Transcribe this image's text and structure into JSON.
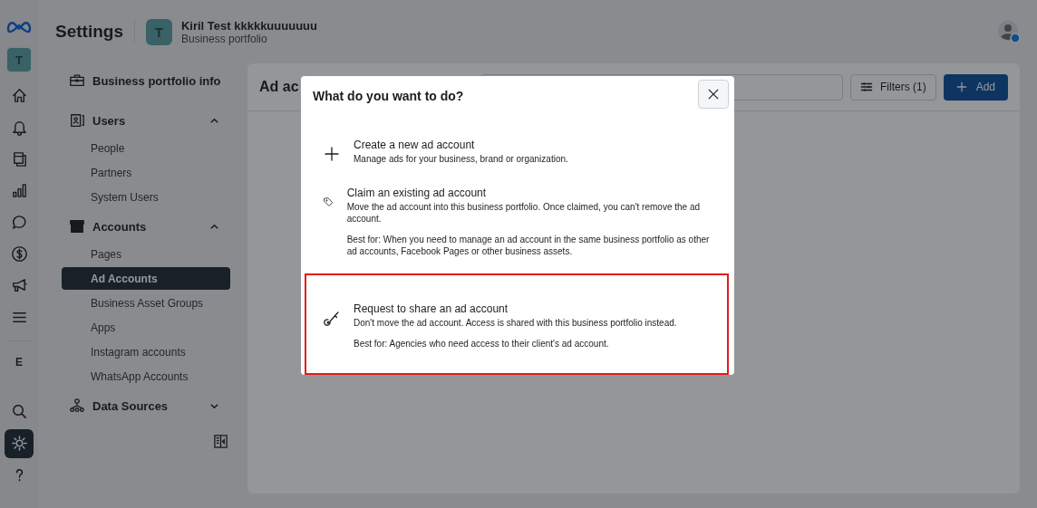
{
  "rail": {
    "account_initial": "T",
    "items": [
      {
        "kind": "home",
        "selected": false
      },
      {
        "kind": "bell",
        "selected": false
      },
      {
        "kind": "pages",
        "selected": false
      },
      {
        "kind": "chart",
        "selected": false
      },
      {
        "kind": "chat",
        "selected": false
      },
      {
        "kind": "dollar",
        "selected": false
      },
      {
        "kind": "megaphone",
        "selected": false
      },
      {
        "kind": "menu",
        "selected": false
      }
    ],
    "section_letter": "E",
    "bottom_items": [
      {
        "kind": "search",
        "selected": false
      },
      {
        "kind": "gear",
        "selected": true
      },
      {
        "kind": "help",
        "selected": false
      }
    ]
  },
  "header": {
    "title": "Settings",
    "portfolio_initial": "T",
    "portfolio_name": "Kiril Test kkkkkuuuuuuu",
    "portfolio_subtitle": "Business portfolio"
  },
  "sidebar": {
    "sections": [
      {
        "kind": "briefcase",
        "label": "Business portfolio info"
      },
      {
        "kind": "users",
        "label": "Users",
        "expanded": true,
        "children": [
          {
            "label": "People",
            "selected": false
          },
          {
            "label": "Partners",
            "selected": false
          },
          {
            "label": "System Users",
            "selected": false
          }
        ]
      },
      {
        "kind": "archive",
        "label": "Accounts",
        "expanded": true,
        "children": [
          {
            "label": "Pages",
            "selected": false
          },
          {
            "label": "Ad Accounts",
            "selected": true
          },
          {
            "label": "Business Asset Groups",
            "selected": false
          },
          {
            "label": "Apps",
            "selected": false
          },
          {
            "label": "Instagram accounts",
            "selected": false
          },
          {
            "label": "WhatsApp Accounts",
            "selected": false
          }
        ]
      },
      {
        "kind": "sources",
        "label": "Data Sources",
        "expanded": false
      }
    ]
  },
  "main": {
    "title": "Ad ac",
    "filters_button": "Filters (1)",
    "add_button": "Add"
  },
  "dialog": {
    "title": "What do you want to do?",
    "options": [
      {
        "kind": "plus",
        "title": "Create a new ad account",
        "description": "Manage ads for your business, brand or organization.",
        "highlighted": false
      },
      {
        "kind": "tag",
        "title": "Claim an existing ad account",
        "description": "Move the ad account into this business portfolio. Once claimed, you can't remove the ad account.",
        "best_for": "Best for: When you need to manage an ad account in the same business portfolio as other ad accounts, Facebook Pages or other business assets.",
        "highlighted": false
      },
      {
        "kind": "key",
        "title": "Request to share an ad account",
        "description": "Don't move the ad account. Access is shared with this business portfolio instead.",
        "best_for": "Best for: Agencies who need access to their client's ad account.",
        "highlighted": true
      }
    ]
  }
}
